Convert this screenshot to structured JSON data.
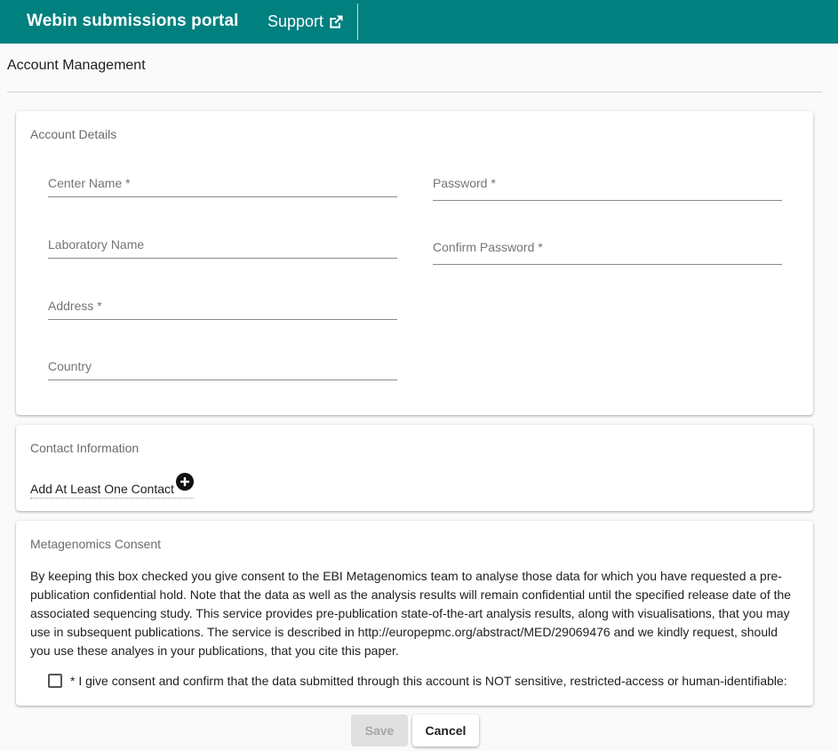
{
  "header": {
    "brand": "Webin submissions portal",
    "support_label": "Support",
    "support_icon": "external-link-icon",
    "background_color": "#00807f"
  },
  "page": {
    "title": "Account Management"
  },
  "account_details": {
    "title": "Account Details",
    "center_name_label": "Center Name *",
    "laboratory_name_label": "Laboratory Name",
    "address_label": "Address *",
    "country_label": "Country",
    "password_label": "Password *",
    "confirm_password_label": "Confirm Password *"
  },
  "contact_information": {
    "title": "Contact Information",
    "add_contact_label": "Add At Least One Contact",
    "add_icon": "plus-circle-icon"
  },
  "metagenomics_consent": {
    "title": "Metagenomics Consent",
    "body": "By keeping this box checked you give consent to the EBI Metagenomics team to analyse those data for which you have requested a pre-publication confidential hold. Note that the data as well as the analysis results will remain confidential until the specified release date of the associated sequencing study. This service provides pre-publication state-of-the-art analysis results, along with visualisations, that you may use in subsequent publications. The service is described in http://europepmc.org/abstract/MED/29069476 and we kindly request, should you use these analyes in your publications, that you cite this paper.",
    "checkbox_label": "* I give consent and confirm that the data submitted through this account is NOT sensitive, restricted-access or human-identifiable:",
    "checked": false
  },
  "actions": {
    "save_label": "Save",
    "cancel_label": "Cancel",
    "save_disabled": true
  }
}
